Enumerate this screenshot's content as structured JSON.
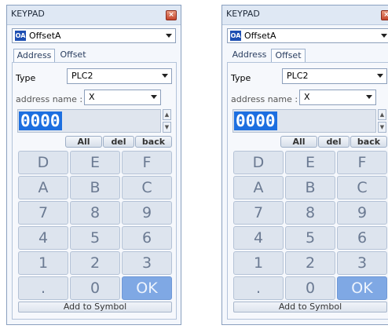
{
  "window": {
    "title": "KEYPAD",
    "close_glyph": "×"
  },
  "device": {
    "icon_text": "OA",
    "label": "OffsetA"
  },
  "tabs": [
    {
      "label": "Address"
    },
    {
      "label": "Offset"
    }
  ],
  "type_field": {
    "label": "Type",
    "value": "PLC2"
  },
  "address_field": {
    "label": "address name :",
    "value": "X"
  },
  "display": {
    "value": "0000"
  },
  "spinner": {
    "up": "▲",
    "down": "▼"
  },
  "functions": {
    "all": "All",
    "del": "del",
    "back": "back"
  },
  "keys": [
    "D",
    "E",
    "F",
    "A",
    "B",
    "C",
    "7",
    "8",
    "9",
    "4",
    "5",
    "6",
    "1",
    "2",
    "3",
    ".",
    "0",
    "OK"
  ],
  "add_to_symbol": "Add to Symbol",
  "panels": [
    {
      "active_tab": "Address"
    },
    {
      "active_tab": "Offset"
    }
  ],
  "colors": {
    "accent": "#1d6fe0",
    "ok_key": "#7fa8e4",
    "key": "#dde4ee"
  }
}
